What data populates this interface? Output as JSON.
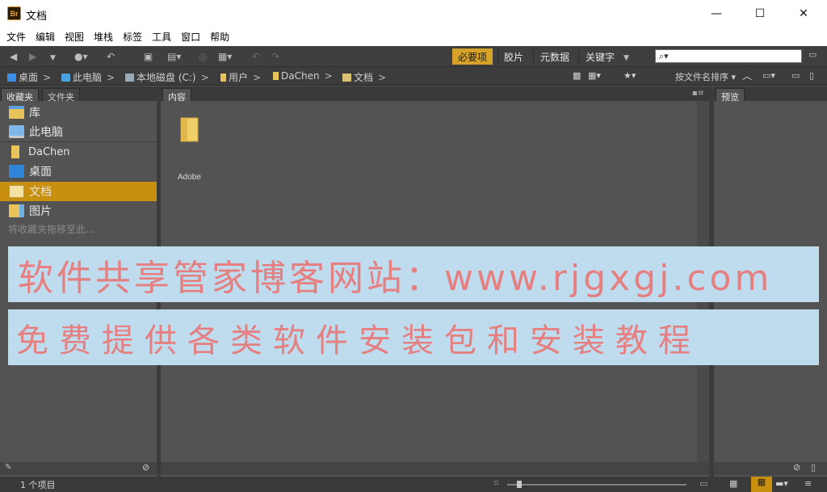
{
  "window": {
    "title": "文档",
    "app_icon_text": "Br",
    "minimize": "—",
    "maximize": "☐",
    "close": "✕"
  },
  "menu": [
    "文件",
    "编辑",
    "视图",
    "堆栈",
    "标签",
    "工具",
    "窗口",
    "帮助"
  ],
  "workspaces": {
    "active": "必要项",
    "items": [
      "胶片",
      "元数据",
      "关键字"
    ]
  },
  "search": {
    "placeholder": ""
  },
  "breadcrumb": [
    "桌面",
    "此电脑",
    "本地磁盘 (C:)",
    "用户",
    "DaChen",
    "文档"
  ],
  "sort_label": "按文件名排序",
  "left_panel": {
    "tabs": [
      "收藏夹",
      "文件夹"
    ],
    "items": [
      {
        "label": "库",
        "icon": "library-icon"
      },
      {
        "label": "此电脑",
        "icon": "computer-icon"
      },
      {
        "label": "DaChen",
        "icon": "user-folder-icon"
      },
      {
        "label": "桌面",
        "icon": "desktop-icon"
      },
      {
        "label": "文档",
        "icon": "documents-icon",
        "selected": true
      },
      {
        "label": "图片",
        "icon": "pictures-icon"
      }
    ],
    "hint": "将收藏夹拖移至此..."
  },
  "content": {
    "tab": "内容",
    "items": [
      {
        "name": "Adobe",
        "type": "folder"
      }
    ]
  },
  "preview": {
    "tab": "预览"
  },
  "status": {
    "count": "1 个项目"
  },
  "colors": {
    "accent": "#d6a229",
    "selected_row": "#c9900f",
    "panel_bg": "#535353",
    "watermark_bg": "#bfdcef",
    "watermark_text": "#e67f7f"
  },
  "watermark": {
    "line1": "软件共享管家博客网站：www.rjgxgj.com",
    "line2": "免费提供各类软件安装包和安装教程"
  }
}
